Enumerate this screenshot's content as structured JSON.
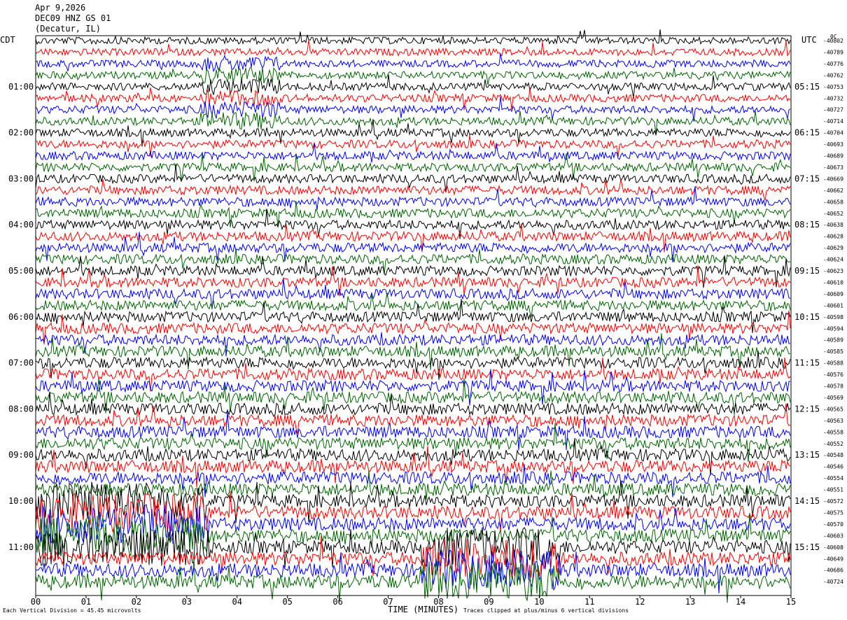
{
  "header": {
    "date": "Apr 9,2026",
    "station": "DEC09 HNZ GS 01",
    "location": "(Decatur, IL)"
  },
  "left_timezone": "CDT",
  "right_timezone": "UTC",
  "right_top_label": "0C",
  "footer": {
    "x_axis_title": "TIME (MINUTES)",
    "scale_note": "Each Vertical Division = 45.45 microvolts",
    "clip_note": "Traces clipped at plus/minus 6 vertical divisions"
  },
  "chart_data": {
    "type": "line",
    "x_axis": {
      "label": "TIME (MINUTES)",
      "range": [
        0,
        15
      ],
      "tick_labels": [
        "00",
        "01",
        "02",
        "03",
        "04",
        "05",
        "06",
        "07",
        "08",
        "09",
        "10",
        "11",
        "12",
        "13",
        "14",
        "15"
      ]
    },
    "rows_per_hour": 4,
    "trace_colors": [
      "#000000",
      "#ff0000",
      "#0000ff",
      "#006400"
    ],
    "left_hour_labels": [
      "01:00",
      "02:00",
      "03:00",
      "04:00",
      "05:00",
      "06:00",
      "07:00",
      "08:00",
      "09:00",
      "10:00",
      "11:00"
    ],
    "right_hour_labels": [
      "05:15",
      "06:15",
      "07:15",
      "08:15",
      "09:15",
      "10:15",
      "11:15",
      "12:15",
      "13:15",
      "14:15",
      "15:15"
    ],
    "right_values": [
      "-40802",
      "-40789",
      "-40776",
      "-40762",
      "-40753",
      "-40732",
      "-40727",
      "-40714",
      "-40704",
      "-40693",
      "-40689",
      "-40673",
      "-40669",
      "-40662",
      "-40658",
      "-40652",
      "-40638",
      "-40628",
      "-40629",
      "-40624",
      "-40623",
      "-40610",
      "-40609",
      "-40601",
      "-40598",
      "-40594",
      "-40589",
      "-40585",
      "-40588",
      "-40576",
      "-40578",
      "-40569",
      "-40565",
      "-40563",
      "-40558",
      "-40552",
      "-40548",
      "-40546",
      "-40554",
      "-40551",
      "-40572",
      "-40575",
      "-40570",
      "-40603",
      "-40608",
      "-40649",
      "-40686",
      "-40724"
    ],
    "grid": false
  }
}
